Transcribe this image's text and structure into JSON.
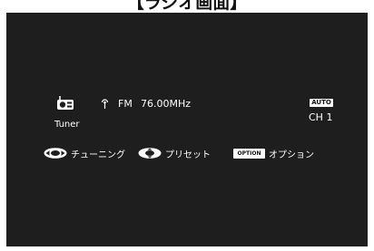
{
  "header": {
    "title": "【ラジオ画面】"
  },
  "screen": {
    "source": {
      "icon": "radio-tuner-icon",
      "label": "Tuner"
    },
    "reception": {
      "icon": "antenna-signal-icon",
      "band": "FM",
      "frequency": "76.00MHz"
    },
    "mode": {
      "badge": "AUTO",
      "channel": "CH 1"
    },
    "guide": {
      "tuning": {
        "icon": "cursor-left-right-icon",
        "label": "チューニング"
      },
      "preset": {
        "icon": "cursor-up-down-icon",
        "label": "プリセット"
      },
      "option": {
        "badge": "OPTION",
        "label": "オプション"
      }
    }
  },
  "colors": {
    "screen_background": "#1e1e1e",
    "text": "#ffffff"
  }
}
